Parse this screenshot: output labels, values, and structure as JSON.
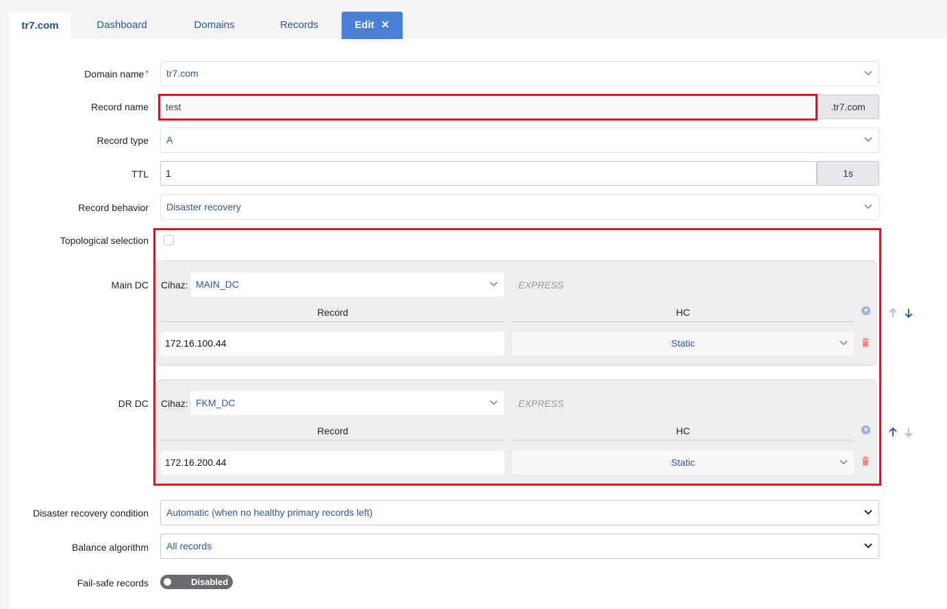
{
  "tabs": {
    "site": "tr7.com",
    "dashboard": "Dashboard",
    "domains": "Domains",
    "records": "Records",
    "edit": "Edit",
    "edit_close": "✕"
  },
  "form": {
    "domain_name": {
      "label": "Domain name",
      "required_mark": "*",
      "value": "tr7.com"
    },
    "record_name": {
      "label": "Record name",
      "value": "test",
      "suffix": ".tr7.com"
    },
    "record_type": {
      "label": "Record type",
      "value": "A"
    },
    "ttl": {
      "label": "TTL",
      "value": "1",
      "suffix": "1s"
    },
    "record_behavior": {
      "label": "Record behavior",
      "value": "Disaster recovery"
    },
    "topological_selection": {
      "label": "Topological selection",
      "checked": false
    },
    "main_dc": {
      "label": "Main DC",
      "cihaz_label": "Cihaz:",
      "cihaz_value": "MAIN_DC",
      "express": "EXPRESS",
      "record_header": "Record",
      "hc_header": "HC",
      "record_value": "172.16.100.44",
      "hc_value": "Static"
    },
    "dr_dc": {
      "label": "DR DC",
      "cihaz_label": "Cihaz:",
      "cihaz_value": "FKM_DC",
      "express": "EXPRESS",
      "record_header": "Record",
      "hc_header": "HC",
      "record_value": "172.16.200.44",
      "hc_value": "Static"
    },
    "dr_condition": {
      "label": "Disaster recovery condition",
      "value": "Automatic (when no healthy primary records left)"
    },
    "balance_algorithm": {
      "label": "Balance algorithm",
      "value": "All records"
    },
    "fail_safe": {
      "label": "Fail-safe records",
      "toggle_text": "Disabled"
    }
  },
  "colors": {
    "highlight": "#e0111f",
    "accent": "#4a80d6",
    "link": "#2f5597"
  }
}
